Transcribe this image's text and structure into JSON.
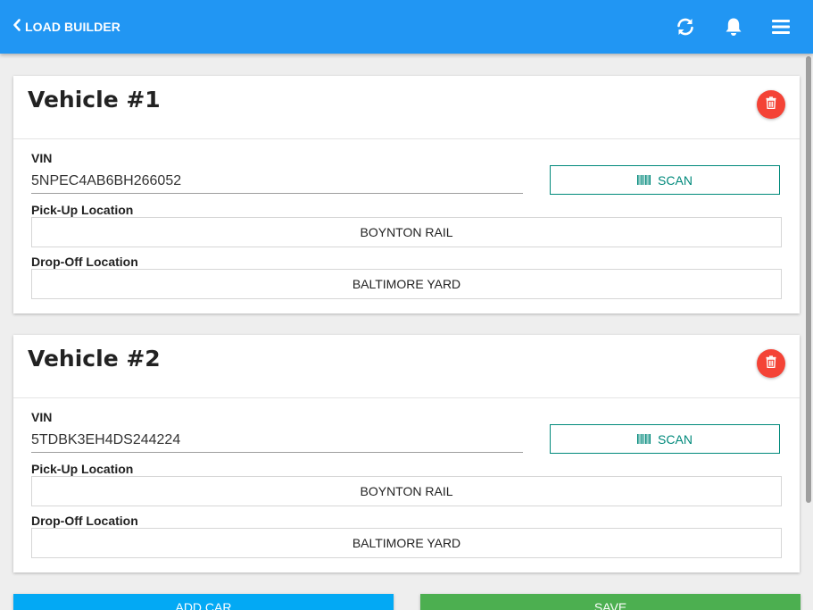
{
  "header": {
    "title": "LOAD BUILDER",
    "icons": [
      "chevron-left-icon",
      "refresh-icon",
      "bell-icon",
      "menu-icon"
    ],
    "color": "#2196f3"
  },
  "vehicles": [
    {
      "title": "Vehicle #1",
      "vin_label": "VIN",
      "vin_value": "5NPEC4AB6BH266052",
      "scan_label": "SCAN",
      "pickup_label": "Pick-Up Location",
      "pickup_value": "BOYNTON RAIL",
      "dropoff_label": "Drop-Off Location",
      "dropoff_value": "BALTIMORE YARD"
    },
    {
      "title": "Vehicle #2",
      "vin_label": "VIN",
      "vin_value": "5TDBK3EH4DS244224",
      "scan_label": "SCAN",
      "pickup_label": "Pick-Up Location",
      "pickup_value": "BOYNTON RAIL",
      "dropoff_label": "Drop-Off Location",
      "dropoff_value": "BALTIMORE YARD"
    }
  ],
  "actions": {
    "add_car_label": "ADD CAR",
    "save_label": "SAVE"
  },
  "colors": {
    "delete": "#f44336",
    "scan": "#00897b",
    "add_car": "#03a9f4",
    "save": "#4caf50"
  }
}
